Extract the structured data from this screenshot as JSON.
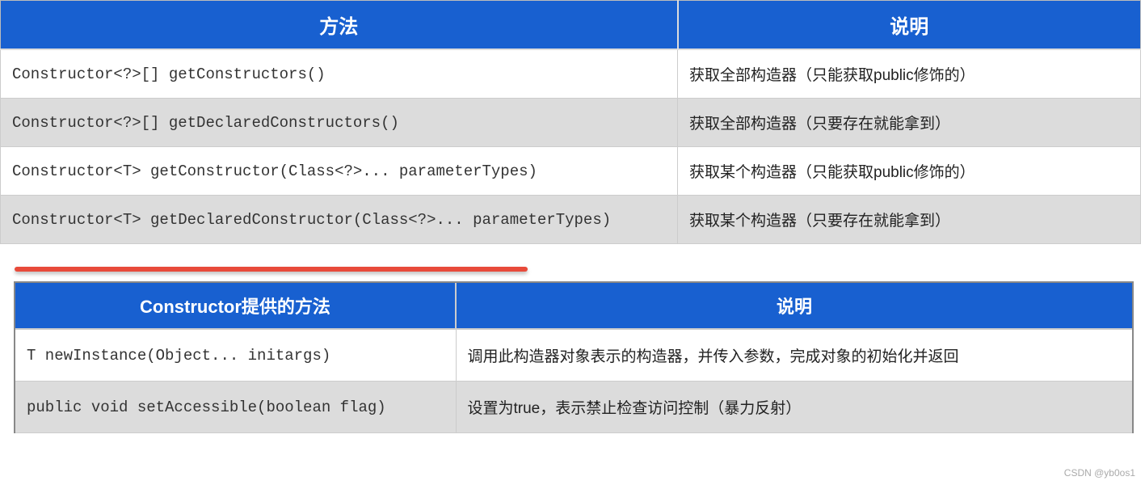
{
  "table1": {
    "headers": [
      "方法",
      "说明"
    ],
    "rows": [
      {
        "method": "Constructor<?>[] getConstructors()",
        "desc": "获取全部构造器（只能获取public修饰的）"
      },
      {
        "method": "Constructor<?>[] getDeclaredConstructors()",
        "desc": "获取全部构造器（只要存在就能拿到）"
      },
      {
        "method": "Constructor<T> getConstructor(Class<?>... parameterTypes)",
        "desc": "获取某个构造器（只能获取public修饰的）"
      },
      {
        "method": "Constructor<T> getDeclaredConstructor(Class<?>... parameterTypes)",
        "desc": "获取某个构造器（只要存在就能拿到）"
      }
    ]
  },
  "table2": {
    "headers": [
      "Constructor提供的方法",
      "说明"
    ],
    "rows": [
      {
        "method": "T newInstance(Object... initargs)",
        "desc": "调用此构造器对象表示的构造器，并传入参数，完成对象的初始化并返回"
      },
      {
        "method": "public void  setAccessible(boolean flag)",
        "desc": "设置为true，表示禁止检查访问控制（暴力反射）"
      }
    ]
  },
  "watermark": "CSDN @yb0os1"
}
